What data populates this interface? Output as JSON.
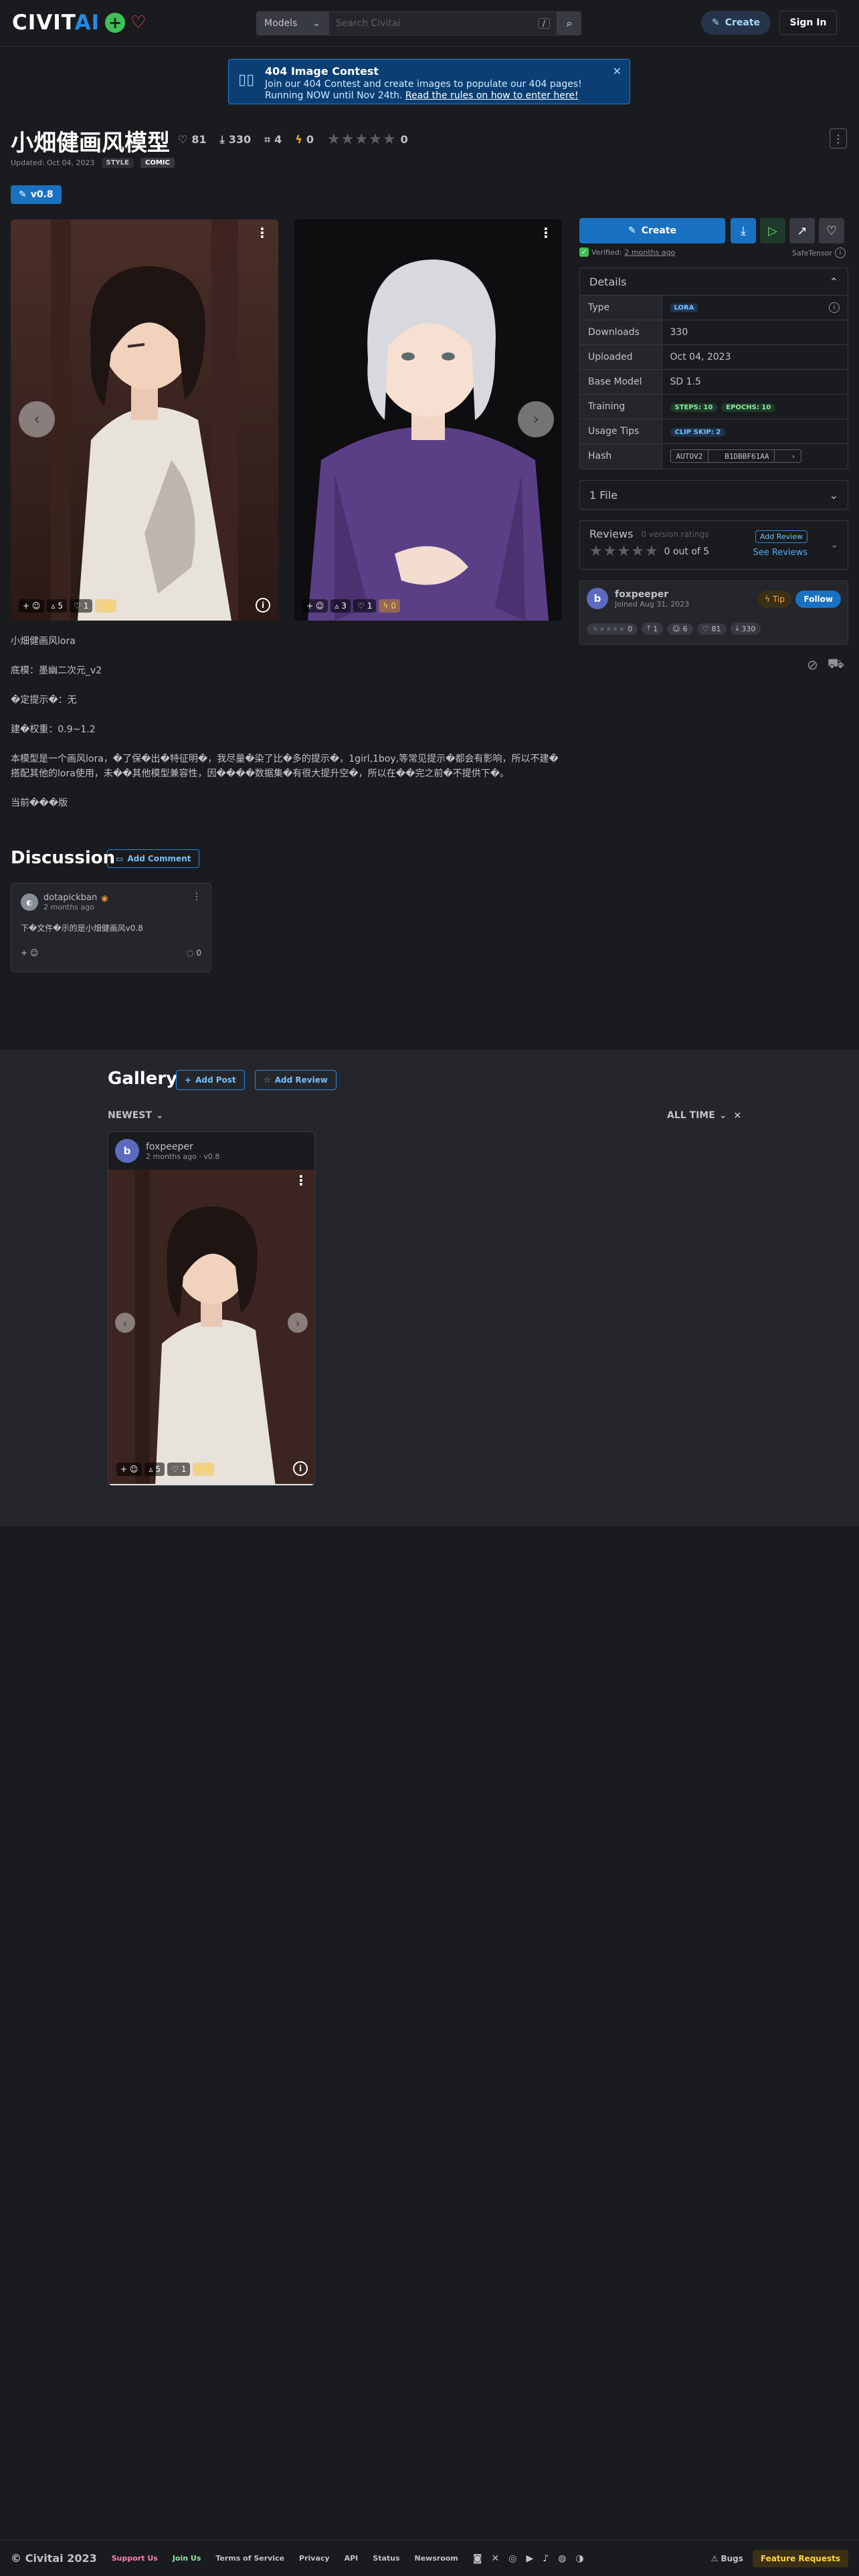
{
  "header": {
    "logo_civit": "CIVIT",
    "logo_ai": "AI",
    "search_category": "Models",
    "search_placeholder": "Search Civitai",
    "search_shortcut": "/",
    "create_label": "Create",
    "signin_label": "Sign In"
  },
  "banner": {
    "title": "404 Image Contest",
    "text": "Join our 404 Contest and create images to populate our 404 pages! Running NOW until Nov 24th.",
    "link": "Read the rules on how to enter here!"
  },
  "model": {
    "title": "小畑健画风模型",
    "likes": "81",
    "downloads": "330",
    "comments": "4",
    "buzz": "0",
    "rating": "0",
    "updated": "Updated: Oct 04, 2023",
    "tags": [
      "STYLE",
      "COMIC"
    ],
    "version": "v0.8"
  },
  "images": [
    {
      "reacts": [
        "5",
        "1",
        "0"
      ],
      "buzz": "0"
    },
    {
      "reacts": [
        "3",
        "1",
        "0"
      ],
      "buzz": "0"
    }
  ],
  "sidebar": {
    "create_label": "Create",
    "verified_label": "Verified:",
    "verified_time": "2 months ago",
    "file_format": "SafeTensor",
    "details_title": "Details",
    "details": [
      {
        "k": "Type",
        "v": "LORA",
        "kind": "badge"
      },
      {
        "k": "Downloads",
        "v": "330",
        "kind": "text"
      },
      {
        "k": "Uploaded",
        "v": "Oct 04, 2023",
        "kind": "text"
      },
      {
        "k": "Base Model",
        "v": "SD 1.5",
        "kind": "text"
      },
      {
        "k": "Training",
        "v": [
          "STEPS: 10",
          "EPOCHS: 10"
        ],
        "kind": "green"
      },
      {
        "k": "Usage Tips",
        "v": "CLIP SKIP: 2",
        "kind": "bluepill"
      },
      {
        "k": "Hash",
        "v": [
          "AUTOV2",
          "B1DBBF61AA"
        ],
        "kind": "hash"
      }
    ],
    "files_label": "1 File",
    "reviews_title": "Reviews",
    "reviews_sub": "0 version ratings",
    "reviews_score": "0 out of 5",
    "add_review_label": "Add Review",
    "see_reviews_label": "See Reviews",
    "creator_name": "foxpeeper",
    "creator_joined": "Joined Aug 31, 2023",
    "creator_initial": "b",
    "tip_label": "Tip",
    "follow_label": "Follow",
    "creator_stats": {
      "rating": "0",
      "uploads": "1",
      "followers": "6",
      "likes": "81",
      "downloads": "330"
    }
  },
  "description": [
    "小畑健画风lora",
    "底模：墨幽二次元_v2",
    "�定提示�：无",
    "建�权重：0.9~1.2",
    "本模型是一个画风lora，�了保�出�特征明�，我尽量�染了比�多的提示�，1girl,1boy,等常见提示�都会有影响，所以不建�搭配其他的lora使用，未��其他模型兼容性，因����数据集�有很大提升空�，所以在��完之前�不提供下�。",
    "当前���版"
  ],
  "discussion": {
    "title": "Discussion",
    "add_comment_label": "Add Comment",
    "comment": {
      "author": "dotapickban",
      "time": "2 months ago",
      "text": "下�文件�示的是小畑健画风v0.8",
      "replies": "0"
    }
  },
  "gallery": {
    "title": "Gallery",
    "add_post_label": "Add Post",
    "add_review_label": "Add Review",
    "sort_label": "NEWEST",
    "time_label": "ALL TIME",
    "card": {
      "user": "foxpeeper",
      "meta": "2 months ago · v0.8",
      "initial": "b",
      "reacts": [
        "5",
        "1"
      ],
      "buzz": "0"
    }
  },
  "footer": {
    "copyright": "© Civitai 2023",
    "links": [
      "Support Us",
      "Join Us",
      "Terms of Service",
      "Privacy",
      "API",
      "Status",
      "Newsroom"
    ],
    "bugs": "Bugs",
    "feature_requests": "Feature Requests"
  }
}
